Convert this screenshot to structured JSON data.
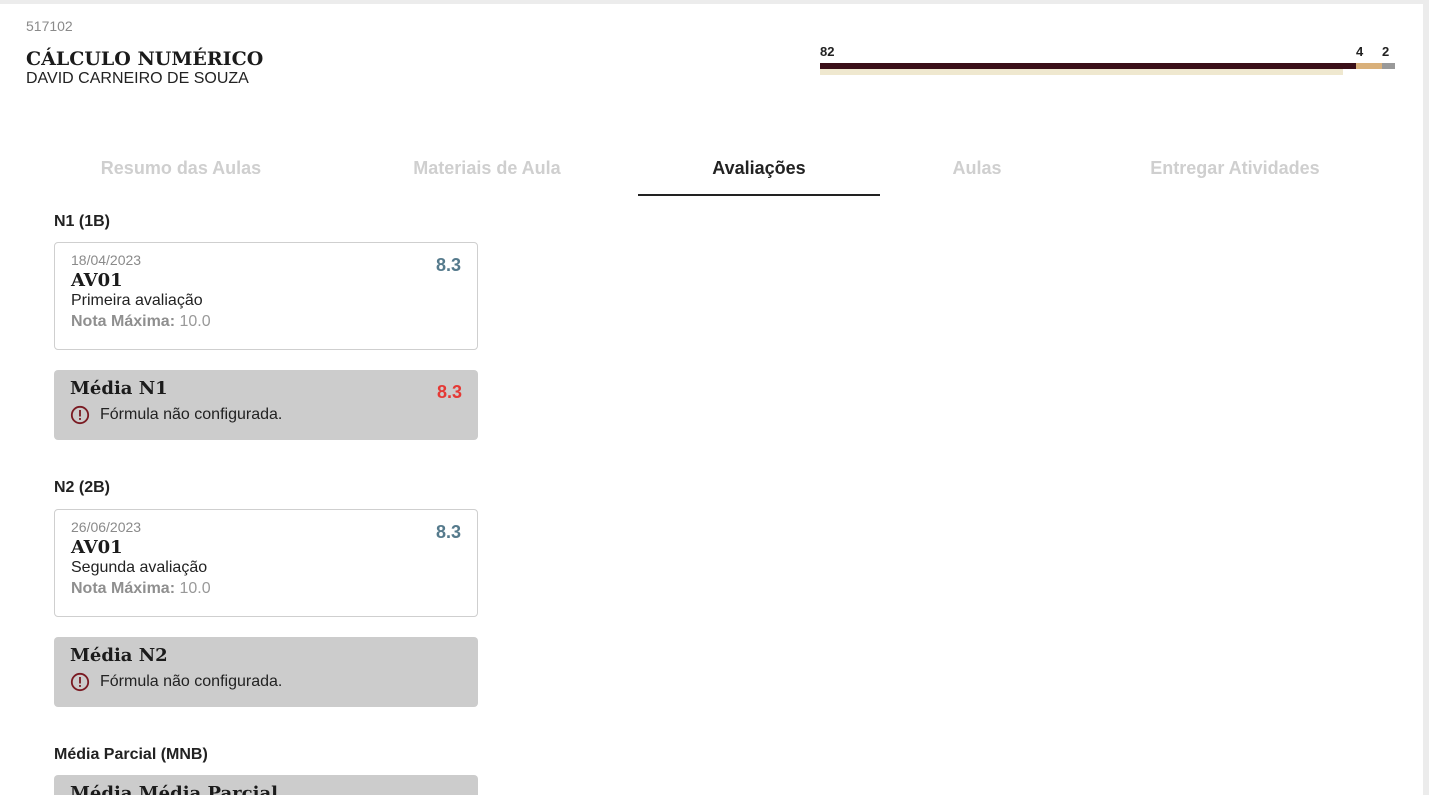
{
  "course": {
    "code": "517102",
    "title": "CÁLCULO NUMÉRICO",
    "teacher": "DAVID CARNEIRO DE SOUZA"
  },
  "attendance": {
    "values": [
      {
        "label": "82",
        "color": "#3a0f18"
      },
      {
        "label": "4",
        "color": "#d9b07a"
      },
      {
        "label": "2",
        "color": "#999999"
      }
    ],
    "secondary_color": "#efe8cf"
  },
  "tabs": [
    {
      "label": "Resumo das Aulas",
      "active": false
    },
    {
      "label": "Materiais de Aula",
      "active": false
    },
    {
      "label": "Avaliações",
      "active": true
    },
    {
      "label": "Aulas",
      "active": false
    },
    {
      "label": "Entregar Atividades",
      "active": false
    }
  ],
  "sections": [
    {
      "title": "N1 (1B)",
      "assessment": {
        "date": "18/04/2023",
        "name": "AV01",
        "description": "Primeira avaliação",
        "max_label": "Nota Máxima:",
        "max_value": "10.0",
        "grade": "8.3"
      },
      "average": {
        "name": "Média N1",
        "grade": "8.3",
        "warning": "Fórmula não configurada."
      }
    },
    {
      "title": "N2 (2B)",
      "assessment": {
        "date": "26/06/2023",
        "name": "AV01",
        "description": "Segunda avaliação",
        "max_label": "Nota Máxima:",
        "max_value": "10.0",
        "grade": "8.3"
      },
      "average": {
        "name": "Média N2",
        "grade": "",
        "warning": "Fórmula não configurada."
      }
    },
    {
      "title": "Média Parcial (MNB)",
      "average": {
        "name": "Média Média Parcial"
      }
    }
  ],
  "colors": {
    "grade_blue": "#557a8c",
    "grade_red": "#e53935",
    "warning_icon": "#7a1a22"
  }
}
